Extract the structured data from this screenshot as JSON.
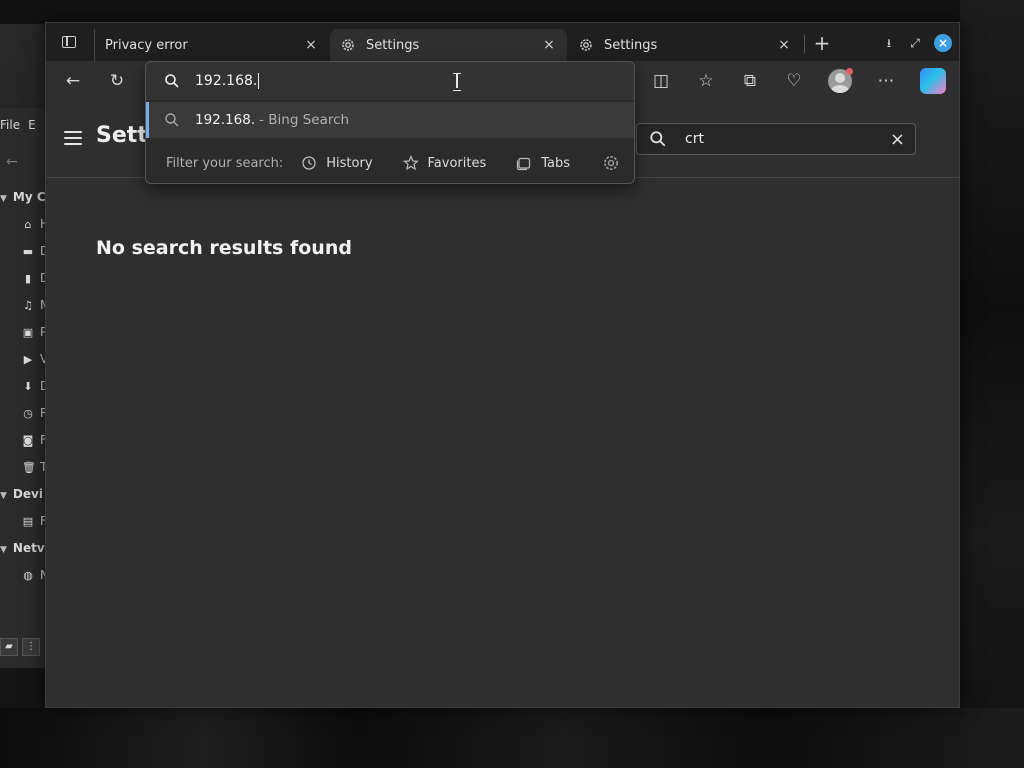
{
  "file_manager": {
    "menu": [
      "File",
      "E"
    ],
    "sections": [
      {
        "label": "My C",
        "items": [
          "home",
          "desktop",
          "documents",
          "music",
          "pictures",
          "videos",
          "downloads",
          "recent",
          "drive",
          "trash"
        ]
      },
      {
        "label": "Devi",
        "items": [
          "disk"
        ]
      },
      {
        "label": "Netv",
        "items": [
          "network"
        ]
      }
    ],
    "item_letters": [
      "H",
      "D",
      "D",
      "M",
      "P",
      "V",
      "D",
      "R",
      "F",
      "T"
    ],
    "device_letter": "F",
    "network_letter": "N"
  },
  "browser": {
    "tabs": [
      {
        "title": "Privacy error",
        "active": false,
        "has_gear": false
      },
      {
        "title": "Settings",
        "active": true,
        "has_gear": true
      },
      {
        "title": "Settings",
        "active": false,
        "has_gear": true
      }
    ],
    "new_tab_glyph": "+",
    "window_controls": [
      "minimize",
      "maximize",
      "close"
    ],
    "close_glyph": "×",
    "accent_color": "#3aa0e0"
  },
  "omnibox": {
    "input_value": "192.168.",
    "suggestion": {
      "query": "192.168.",
      "source": "- Bing Search"
    },
    "filter_label": "Filter your search:",
    "filters": [
      "History",
      "Favorites",
      "Tabs"
    ],
    "highlight_color": "#78aef0"
  },
  "settings_page": {
    "title": "Settings",
    "search_value": "crt",
    "no_results_text": "No search results found"
  },
  "icons": {
    "toolbar": [
      "back-arrow-icon",
      "refresh-icon",
      "split-screen-icon",
      "favorites-icon",
      "collections-icon",
      "browser-essentials-icon",
      "profile-icon",
      "more-icon",
      "copilot-icon"
    ]
  }
}
